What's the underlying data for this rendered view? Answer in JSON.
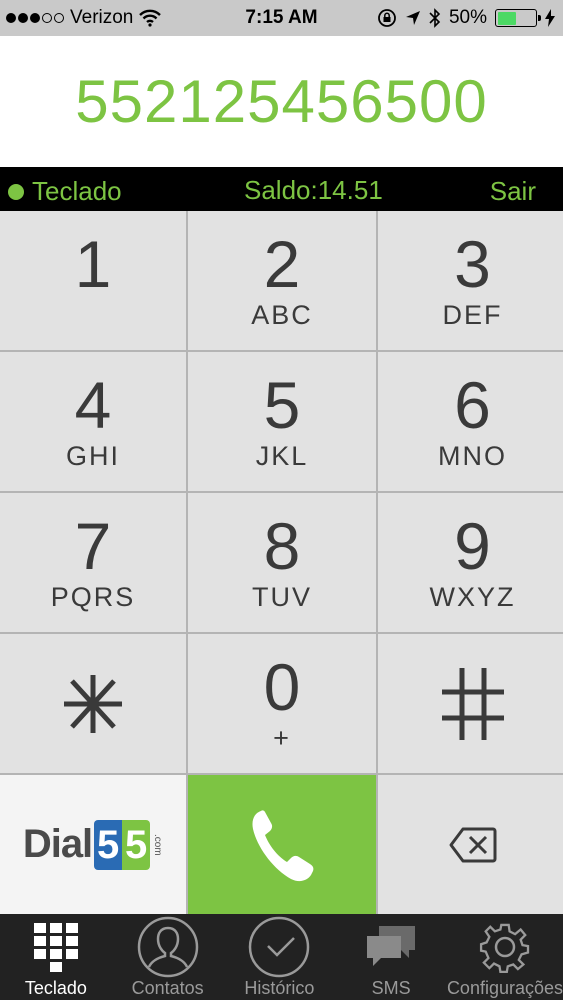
{
  "status": {
    "carrier": "Verizon",
    "time": "7:15 AM",
    "battery": "50%",
    "battery_level": 0.5
  },
  "display": {
    "number": "552125456500"
  },
  "info": {
    "tab_label": "Teclado",
    "saldo": "Saldo:14.51",
    "sair": "Sair"
  },
  "keys": [
    {
      "digit": "1",
      "letters": ""
    },
    {
      "digit": "2",
      "letters": "ABC"
    },
    {
      "digit": "3",
      "letters": "DEF"
    },
    {
      "digit": "4",
      "letters": "GHI"
    },
    {
      "digit": "5",
      "letters": "JKL"
    },
    {
      "digit": "6",
      "letters": "MNO"
    },
    {
      "digit": "7",
      "letters": "PQRS"
    },
    {
      "digit": "8",
      "letters": "TUV"
    },
    {
      "digit": "9",
      "letters": "WXYZ"
    },
    {
      "digit": "0",
      "letters": "+"
    }
  ],
  "logo": {
    "text": "Dial",
    "num1": "5",
    "num2": "5",
    "suffix": ".com"
  },
  "tabs": [
    {
      "label": "Teclado",
      "icon": "keypad-grid-icon"
    },
    {
      "label": "Contatos",
      "icon": "person-icon"
    },
    {
      "label": "Histórico",
      "icon": "clock-icon"
    },
    {
      "label": "SMS",
      "icon": "chat-bubbles-icon"
    },
    {
      "label": "Configurações",
      "icon": "gear-icon"
    }
  ],
  "colors": {
    "accent": "#7dc443",
    "logo_blue": "#2a6bb4"
  }
}
